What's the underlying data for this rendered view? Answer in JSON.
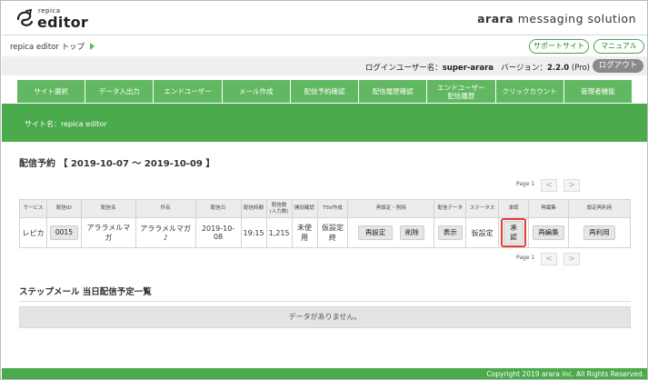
{
  "header": {
    "logo_small": "repica",
    "logo_big": "editor",
    "brand_bold": "arara",
    "brand_rest": " messaging solution"
  },
  "breadcrumb": {
    "label": "repica editor トップ"
  },
  "links": {
    "support": "サポートサイト",
    "manual": "マニュアル"
  },
  "login": {
    "user_label": "ログインユーザー名：",
    "user": "super-arara",
    "version_label": "バージョン：",
    "version": "2.2.0",
    "edition": " (Pro)",
    "logout": "ログアウト"
  },
  "nav": {
    "items": [
      {
        "label": "サイト選択"
      },
      {
        "label": "データ入出力"
      },
      {
        "label": "エンドユーザー"
      },
      {
        "label": "メール作成"
      },
      {
        "label": "配信予約確認"
      },
      {
        "label": "配信履歴確認"
      },
      {
        "label": "エンドユーザー\n配信履歴"
      },
      {
        "label": "クリックカウント"
      },
      {
        "label": "管理者機能"
      }
    ]
  },
  "site": {
    "label": "サイト名：repica editor"
  },
  "reservation": {
    "title": "配信予約 【 2019-10-07 〜 2019-10-09 】",
    "page_label": "Page 1",
    "prev": "<",
    "next": ">",
    "headers": [
      "サービス",
      "配信ID",
      "配信名",
      "件名",
      "配信日",
      "配信時間",
      "配信数\n(入力数)",
      "開封確認",
      "TSV作成",
      "再設定・削除",
      "配信データ",
      "ステータス",
      "承認",
      "再編集",
      "設定再利用"
    ],
    "row": {
      "service": "レピカ",
      "id": "0015",
      "name": "アララメルマガ",
      "subject": "アララメルマガ♪",
      "date": "2019-10-08",
      "time": "19:15",
      "count": "1,215",
      "open": "未使用",
      "tsv": "仮設定終",
      "reset": "再設定",
      "delete": "削除",
      "show": "表示",
      "status": "仮設定",
      "approve": "承認",
      "reedit": "再編集",
      "reuse": "再利用"
    }
  },
  "step": {
    "title": "ステップメール 当日配信予定一覧",
    "nodata": "データがありません。"
  },
  "footer": {
    "copyright": "Copyright 2019 arara inc. All Rights Reserved."
  },
  "colors": {
    "accent": "#4aaa4c",
    "nav": "#62b862",
    "approve_border": "#e53935"
  }
}
